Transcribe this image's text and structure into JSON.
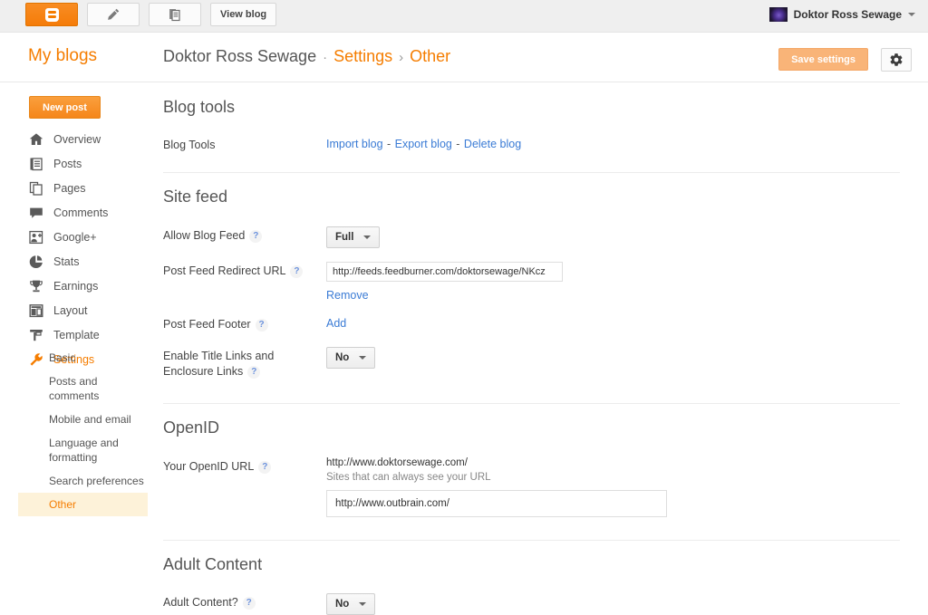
{
  "topbar": {
    "buttons": [
      {
        "name": "blogger-home-button",
        "icon": "blogger-logo-icon",
        "label": ""
      },
      {
        "name": "new-post-pencil-button",
        "icon": "pencil-icon",
        "label": ""
      },
      {
        "name": "posts-list-button",
        "icon": "documents-icon",
        "label": ""
      },
      {
        "name": "view-blog-button",
        "icon": "",
        "label": "View blog"
      }
    ],
    "user": {
      "name": "Doktor Ross Sewage",
      "avatar_icon": "user-avatar",
      "caret_icon": "chevron-down-icon"
    }
  },
  "header": {
    "my_blogs": "My blogs",
    "blog_name": "Doktor Ross Sewage",
    "separator_dot": "·",
    "settings_label": "Settings",
    "separator_chevron": "›",
    "current_page": "Other",
    "save_label": "Save settings",
    "gear_icon": "gear-icon"
  },
  "sidebar": {
    "new_post": "New post",
    "items": [
      {
        "label": "Overview",
        "icon": "home-icon",
        "active": false
      },
      {
        "label": "Posts",
        "icon": "posts-icon",
        "active": false
      },
      {
        "label": "Pages",
        "icon": "pages-icon",
        "active": false
      },
      {
        "label": "Comments",
        "icon": "comment-icon",
        "active": false
      },
      {
        "label": "Google+",
        "icon": "google-plus-icon",
        "active": false
      },
      {
        "label": "Stats",
        "icon": "pie-chart-icon",
        "active": false
      },
      {
        "label": "Earnings",
        "icon": "trophy-icon",
        "active": false
      },
      {
        "label": "Layout",
        "icon": "layout-icon",
        "active": false
      },
      {
        "label": "Template",
        "icon": "template-icon",
        "active": false
      },
      {
        "label": "Settings",
        "icon": "wrench-icon",
        "active": true
      }
    ],
    "subitems": [
      {
        "label": "Basic",
        "active": false
      },
      {
        "label": "Posts and comments",
        "active": false
      },
      {
        "label": "Mobile and email",
        "active": false
      },
      {
        "label": "Language and formatting",
        "active": false
      },
      {
        "label": "Search preferences",
        "active": false
      },
      {
        "label": "Other",
        "active": true
      }
    ]
  },
  "sections": {
    "blog_tools": {
      "title": "Blog tools",
      "row_label": "Blog Tools",
      "import_link": "Import blog",
      "export_link": "Export blog",
      "delete_link": "Delete blog",
      "dash": "-"
    },
    "site_feed": {
      "title": "Site feed",
      "allow_feed_label": "Allow Blog Feed",
      "allow_feed_value": "Full",
      "redirect_label": "Post Feed Redirect URL",
      "redirect_value": "http://feeds.feedburner.com/doktorsewage/NKcz",
      "remove_link": "Remove",
      "footer_label": "Post Feed Footer",
      "add_link": "Add",
      "enclosure_label": "Enable Title Links and Enclosure Links",
      "enclosure_value": "No",
      "help_glyph": "?"
    },
    "openid": {
      "title": "OpenID",
      "url_label": "Your OpenID URL",
      "url_value": "http://www.doktorsewage.com/",
      "sites_note": "Sites that can always see your URL",
      "sites_value": "http://www.outbrain.com/"
    },
    "adult_content": {
      "title": "Adult Content",
      "row_label": "Adult Content?",
      "value": "No"
    }
  },
  "colors": {
    "accent": "#f57d00",
    "link": "#3a7bd5",
    "highlight": "#fdf2d9"
  }
}
